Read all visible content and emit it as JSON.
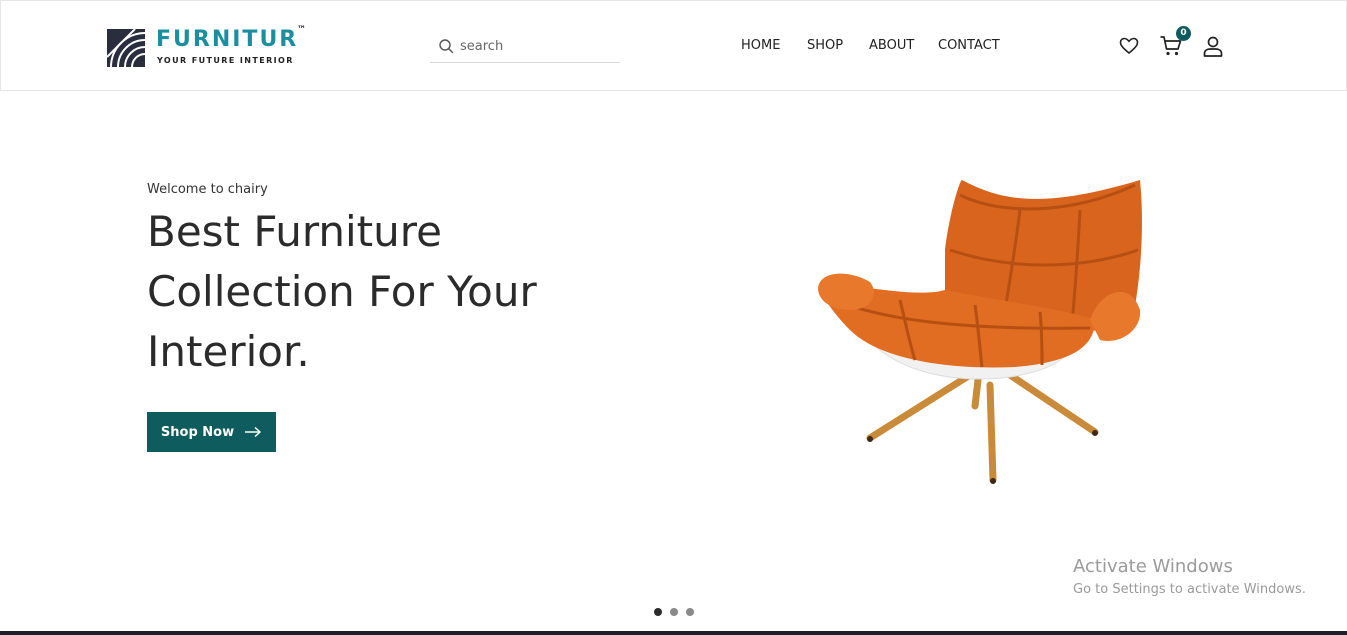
{
  "brand": {
    "name": "FURNITUR",
    "tm": "™",
    "tagline": "YOUR FUTURE INTERIOR",
    "color": "#1b8fa0"
  },
  "search": {
    "placeholder": "search",
    "value": "",
    "icon": "search-icon"
  },
  "nav": {
    "items": [
      "HOME",
      "SHOP",
      "ABOUT",
      "CONTACT"
    ]
  },
  "header_icons": {
    "wishlist": "heart-icon",
    "cart": "cart-icon",
    "cart_count": "0",
    "account": "user-icon"
  },
  "hero": {
    "welcome": "Welcome to chairy",
    "headline_lines": [
      "Best Furniture",
      "Collection For Your",
      "Interior."
    ],
    "button_label": "Shop Now",
    "button_icon": "arrow-right-icon",
    "image": "orange-lounge-chair",
    "accent": "#0f5c5e"
  },
  "carousel": {
    "dots": 3,
    "active": 1
  },
  "watermark": {
    "title": "Activate Windows",
    "subtitle": "Go to Settings to activate Windows."
  }
}
